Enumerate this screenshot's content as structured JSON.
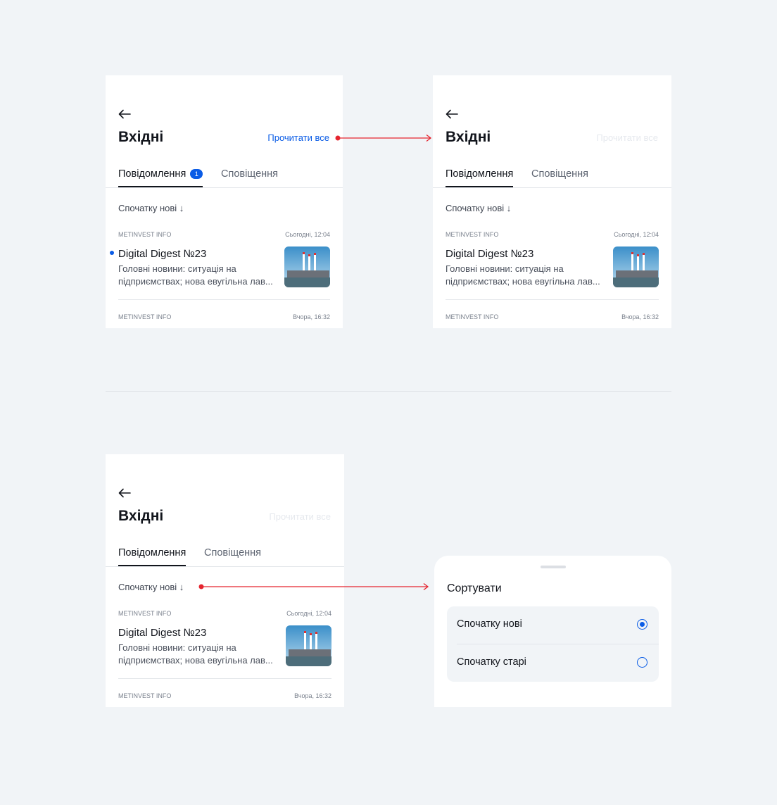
{
  "screens": [
    {
      "back_icon": "arrow-left-icon",
      "title": "Вхідні",
      "read_all": "Прочитати все",
      "tabs": {
        "messages": "Повідомлення",
        "messages_badge": "1",
        "notifications": "Сповіщення"
      },
      "sort": "Спочатку нові ↓",
      "items": [
        {
          "source": "METINVEST INFO",
          "time": "Сьогодні, 12:04",
          "title": "Digital Digest №23",
          "body_l1": "Головні новини: ситуація на",
          "body_l2": "підприємствах; нова евугільна лав..."
        },
        {
          "source": "METINVEST INFO",
          "time": "Вчора, 16:32"
        }
      ]
    },
    {
      "back_icon": "arrow-left-icon",
      "title": "Вхідні",
      "read_all": "Прочитати все",
      "tabs": {
        "messages": "Повідомлення",
        "notifications": "Сповіщення"
      },
      "sort": "Спочатку нові ↓",
      "items": [
        {
          "source": "METINVEST INFO",
          "time": "Сьогодні, 12:04",
          "title": "Digital Digest №23",
          "body_l1": "Головні новини: ситуація на",
          "body_l2": "підприємствах; нова евугільна лав..."
        },
        {
          "source": "METINVEST INFO",
          "time": "Вчора, 16:32"
        }
      ]
    },
    {
      "back_icon": "arrow-left-icon",
      "title": "Вхідні",
      "read_all": "Прочитати все",
      "tabs": {
        "messages": "Повідомлення",
        "notifications": "Сповіщення"
      },
      "sort": "Спочатку нові ↓",
      "items": [
        {
          "source": "METINVEST INFO",
          "time": "Сьогодні, 12:04",
          "title": "Digital Digest №23",
          "body_l1": "Головні новини: ситуація на",
          "body_l2": "підприємствах; нова евугільна лав..."
        },
        {
          "source": "METINVEST INFO",
          "time": "Вчора, 16:32"
        }
      ]
    }
  ],
  "sort_sheet": {
    "title": "Сортувати",
    "options": [
      {
        "label": "Спочатку нові",
        "selected": true
      },
      {
        "label": "Спочатку старі",
        "selected": false
      }
    ]
  },
  "colors": {
    "accent": "#0a5ce6",
    "annotation": "#e5252f",
    "background": "#f1f4f7"
  }
}
